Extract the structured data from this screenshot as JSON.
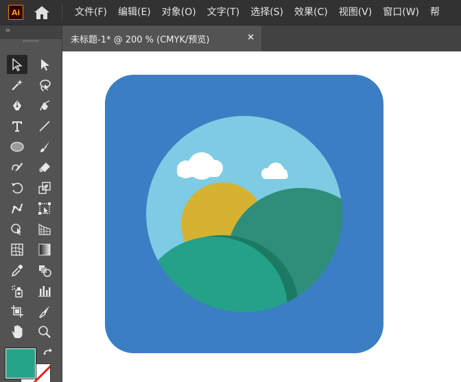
{
  "app": {
    "logo_text": "Ai",
    "home_icon": "home-icon"
  },
  "menu": {
    "items": [
      {
        "label": "文件(F)"
      },
      {
        "label": "编辑(E)"
      },
      {
        "label": "对象(O)"
      },
      {
        "label": "文字(T)"
      },
      {
        "label": "选择(S)"
      },
      {
        "label": "效果(C)"
      },
      {
        "label": "视图(V)"
      },
      {
        "label": "窗口(W)"
      },
      {
        "label": "帮"
      }
    ]
  },
  "document_tab": {
    "title": "未标题-1* @ 200 % (CMYK/预览)",
    "close_label": "×"
  },
  "toolbar": {
    "collapse_label": "‹‹",
    "tools": [
      {
        "name": "selection-tool-icon",
        "selected": true
      },
      {
        "name": "direct-selection-tool-icon"
      },
      {
        "name": "magic-wand-tool-icon"
      },
      {
        "name": "lasso-tool-icon"
      },
      {
        "name": "pen-tool-icon"
      },
      {
        "name": "curvature-tool-icon"
      },
      {
        "name": "type-tool-icon"
      },
      {
        "name": "line-segment-tool-icon"
      },
      {
        "name": "ellipse-tool-icon"
      },
      {
        "name": "paintbrush-tool-icon"
      },
      {
        "name": "shaper-tool-icon"
      },
      {
        "name": "eraser-tool-icon"
      },
      {
        "name": "rotate-tool-icon"
      },
      {
        "name": "scale-tool-icon"
      },
      {
        "name": "puppet-warp-tool-icon"
      },
      {
        "name": "free-transform-tool-icon"
      },
      {
        "name": "shape-builder-tool-icon"
      },
      {
        "name": "perspective-grid-tool-icon"
      },
      {
        "name": "mesh-tool-icon"
      },
      {
        "name": "gradient-tool-icon"
      },
      {
        "name": "eyedropper-tool-icon"
      },
      {
        "name": "blend-tool-icon"
      },
      {
        "name": "symbol-sprayer-tool-icon"
      },
      {
        "name": "column-graph-tool-icon"
      },
      {
        "name": "artboard-tool-icon"
      },
      {
        "name": "slice-tool-icon"
      },
      {
        "name": "hand-tool-icon"
      },
      {
        "name": "zoom-tool-icon"
      }
    ],
    "fill_color": "#26a48a",
    "stroke_color": "none"
  },
  "artwork": {
    "background": "#3b7ec3",
    "sky": "#7ecbe4",
    "sun": "#d6b231",
    "hill_back": "#2e8e79",
    "hill_front": "#25a18a",
    "hill_shadow": "#1a7a62",
    "cloud": "#ffffff"
  }
}
